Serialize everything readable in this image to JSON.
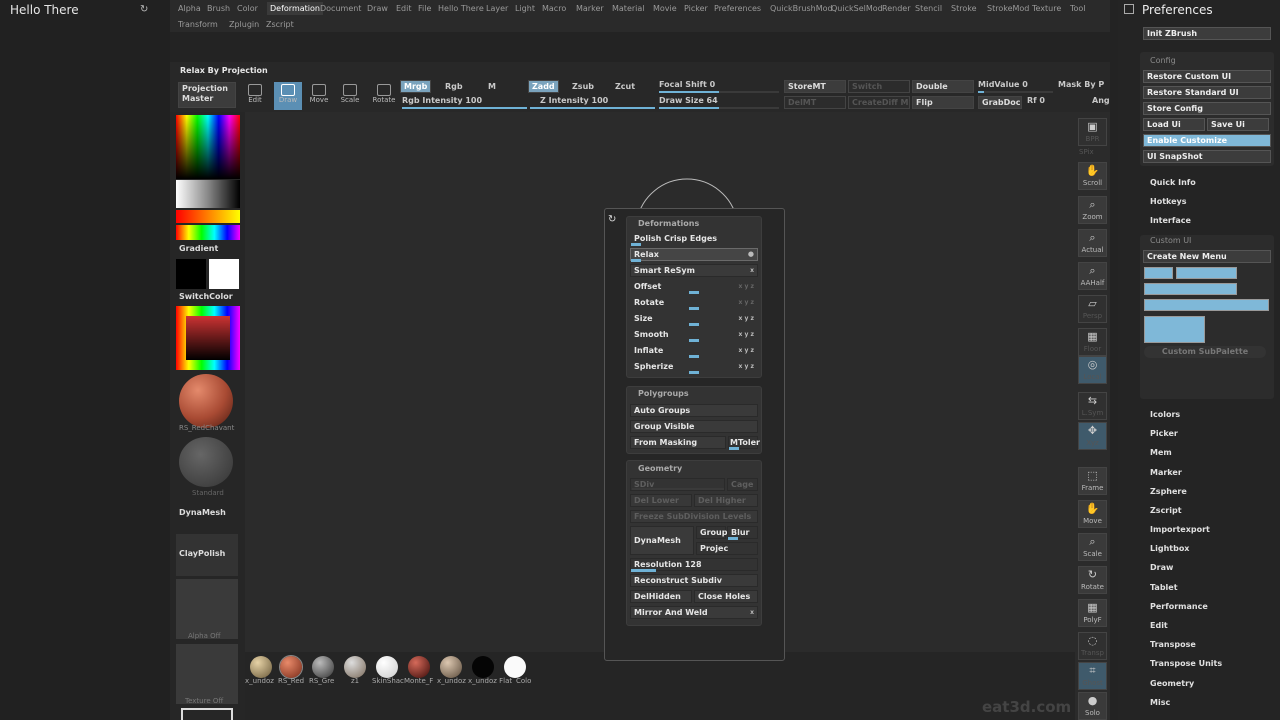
{
  "app": {
    "panel_title": "Hello There",
    "watermark": "eat3d.com"
  },
  "menu": {
    "row1": [
      "Alpha",
      "Brush",
      "Color",
      "Deformation",
      "Document",
      "Draw",
      "Edit",
      "File",
      "Hello There",
      "Layer",
      "Light",
      "Macro",
      "Marker",
      "Material",
      "Movie",
      "Picker",
      "Preferences",
      "QuickBrushMod",
      "QuickSelMod",
      "Render",
      "Stencil",
      "Stroke",
      "StrokeMod",
      "Texture",
      "Tool"
    ],
    "row2": [
      "Transform",
      "Zplugin",
      "Zscript"
    ],
    "active": "Deformation"
  },
  "toolbar": {
    "info": "Relax By Projection",
    "projection_master": "Projection Master",
    "tools": [
      "Edit",
      "Draw",
      "Move",
      "Scale",
      "Rotate"
    ],
    "mrgb": "Mrgb",
    "rgb": "Rgb",
    "m": "M",
    "zadd": "Zadd",
    "zsub": "Zsub",
    "zcut": "Zcut",
    "rgb_intensity": "Rgb Intensity 100",
    "z_intensity": "Z Intensity 100",
    "focal_shift": "Focal Shift 0",
    "draw_size": "Draw Size 64",
    "storemt": "StoreMT",
    "delmt": "DelMT",
    "switch": "Switch",
    "creatediff": "CreateDiff M",
    "double": "Double",
    "flip": "Flip",
    "midvalue": "MidValue 0",
    "grabdoc": "GrabDoc",
    "rf": "Rf 0",
    "mask_by": "Mask By P",
    "ang": "Ang"
  },
  "left_tray": {
    "gradient": "Gradient",
    "switchcolor": "SwitchColor",
    "material_label": "RS_RedChavant",
    "standard_label": "Standard",
    "dynamesh": "DynaMesh",
    "claypolish": "ClayPolish",
    "alpha_off": "Alpha Off",
    "texture_off": "Texture Off"
  },
  "right_tray": {
    "tools": [
      "BPR",
      "SPix",
      "Scroll",
      "Zoom",
      "Actual",
      "AAHalf",
      "Persp",
      "Floor",
      "Local",
      "L.Sym",
      "Xyz",
      "",
      "Frame",
      "Move",
      "Scale",
      "Rotate",
      "PolyF",
      "Transp",
      "Ghost",
      "Solo"
    ]
  },
  "deformation_panel": {
    "deformations_header": "Deformations",
    "deformations": [
      {
        "label": "Polish Crisp Edges",
        "type": "slider"
      },
      {
        "label": "Relax",
        "type": "button",
        "selected": true
      },
      {
        "label": "Smart ReSym",
        "type": "button",
        "xyz": "x"
      },
      {
        "label": "Offset",
        "type": "slider",
        "xyz": "x y z"
      },
      {
        "label": "Rotate",
        "type": "slider",
        "xyz": "x y z"
      },
      {
        "label": "Size",
        "type": "slider",
        "xyz": "x y z"
      },
      {
        "label": "Smooth",
        "type": "slider",
        "xyz": "x y z"
      },
      {
        "label": "Inflate",
        "type": "slider",
        "xyz": "x y z"
      },
      {
        "label": "Spherize",
        "type": "slider",
        "xyz": "x y z"
      }
    ],
    "polygroups_header": "Polygroups",
    "polygroups": [
      "Auto Groups",
      "Group Visible",
      "From Masking"
    ],
    "mtoler": "MToler",
    "geometry_header": "Geometry",
    "sdiv": "SDiv",
    "cage": "Cage",
    "del_lower": "Del Lower",
    "del_higher": "Del Higher",
    "freeze": "Freeze SubDivision Levels",
    "dynamesh": "DynaMesh",
    "group": "Group",
    "blur": "Blur",
    "project": "Projec",
    "resolution": "Resolution 128",
    "reconstruct": "Reconstruct Subdiv",
    "delhidden": "DelHidden",
    "close_holes": "Close Holes",
    "mirror_weld": "Mirror And Weld"
  },
  "bottom_materials": [
    "x_undoz",
    "RS_Red",
    "RS_Gre",
    "z1",
    "SkinShac",
    "Monte_F",
    "x_undoz",
    "x_undoz Flat",
    "Colo"
  ],
  "preferences": {
    "title": "Preferences",
    "init": "Init ZBrush",
    "config_header": "Config",
    "restore_custom": "Restore Custom UI",
    "restore_standard": "Restore Standard UI",
    "store_config": "Store Config",
    "load_ui": "Load Ui",
    "save_ui": "Save Ui",
    "enable_customize": "Enable Customize",
    "ui_snapshot": "UI SnapShot",
    "quick_info": "Quick Info",
    "hotkeys": "Hotkeys",
    "interface": "Interface",
    "custom_ui_header": "Custom UI",
    "create_new_menu": "Create New Menu",
    "custom_subpalette": "Custom SubPalette",
    "sections": [
      "Icolors",
      "Picker",
      "Mem",
      "Marker",
      "Zsphere",
      "Zscript",
      "Importexport",
      "Lightbox",
      "Draw",
      "Tablet",
      "Performance",
      "Edit",
      "Transpose",
      "Transpose Units",
      "Geometry",
      "Misc"
    ]
  },
  "colors": {
    "accent": "#7fb8d8",
    "slider": "#6fb2d6",
    "material_red": "#b0503a"
  }
}
